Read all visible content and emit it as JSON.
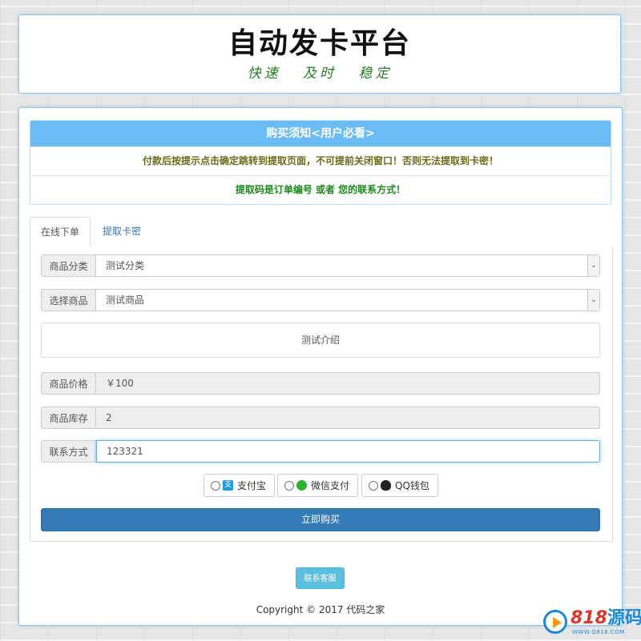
{
  "header": {
    "title": "自动发卡平台",
    "slogan": "快速 及时 稳定"
  },
  "notice": {
    "heading": "购买须知<用户必看>",
    "line1": "付款后按提示点击确定跳转到提取页面，不可提前关闭窗口！否则无法提取到卡密！",
    "line2": "提取码是订单编号 或者 您的联系方式！"
  },
  "tabs": [
    {
      "label": "在线下单",
      "active": true
    },
    {
      "label": "提取卡密",
      "active": false
    }
  ],
  "form": {
    "category": {
      "label": "商品分类",
      "value": "测试分类"
    },
    "product": {
      "label": "选择商品",
      "value": "测试商品"
    },
    "intro": "测试介绍",
    "price": {
      "label": "商品价格",
      "value": "￥100"
    },
    "stock": {
      "label": "商品库存",
      "value": "2"
    },
    "contact": {
      "label": "联系方式",
      "value": "123321"
    },
    "payments": [
      {
        "label": "支付宝",
        "icon": "alipay-icon"
      },
      {
        "label": "微信支付",
        "icon": "wechat-icon"
      },
      {
        "label": "QQ钱包",
        "icon": "qq-wallet-icon"
      }
    ],
    "buy_label": "立即购买"
  },
  "footer": {
    "contact_label": "联系客服",
    "copyright": "Copyright © 2017 代码之家"
  },
  "watermark": {
    "num": "818",
    "text": "源码",
    "url": "WWW.Q818.COM"
  },
  "colors": {
    "notice_heading_bg": "#6bbcf5",
    "primary": "#337ab7",
    "info": "#5bc0de",
    "slogan": "#2a7a2a"
  }
}
